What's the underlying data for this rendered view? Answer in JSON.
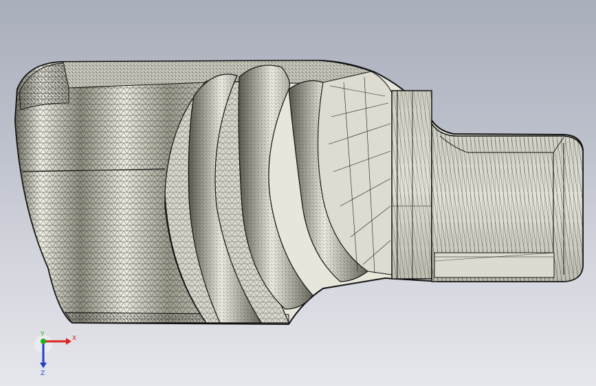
{
  "triad": {
    "x_label": "X",
    "y_label": "Y",
    "z_label": "Z",
    "x_color": "#e02020",
    "y_color": "#20b020",
    "z_color": "#2040c8"
  },
  "model": {
    "display_mode": "mesh-wireframe",
    "body_color": "#e9e8dc",
    "edge_color": "#1a1a1a"
  },
  "viewport": {
    "background_top": "#a9aebb",
    "background_bottom": "#e6e7ec"
  }
}
